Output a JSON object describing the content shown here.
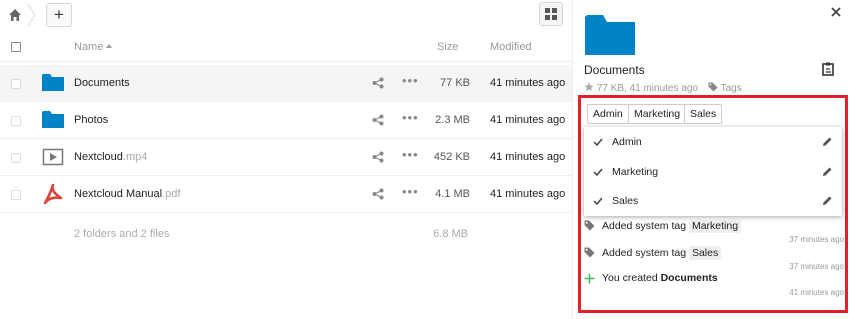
{
  "toolbar": {
    "add_label": "+"
  },
  "file_list": {
    "header": {
      "name": "Name",
      "size": "Size",
      "modified": "Modified"
    },
    "rows": [
      {
        "name": "Documents",
        "ext": "",
        "size": "77 KB",
        "modified": "41 minutes ago",
        "icon": "folder-icon"
      },
      {
        "name": "Photos",
        "ext": "",
        "size": "2.3 MB",
        "modified": "41 minutes ago",
        "icon": "folder-icon"
      },
      {
        "name": "Nextcloud",
        "ext": ".mp4",
        "size": "452 KB",
        "modified": "41 minutes ago",
        "icon": "video-file-icon"
      },
      {
        "name": "Nextcloud Manual",
        "ext": ".pdf",
        "size": "4.1 MB",
        "modified": "41 minutes ago",
        "icon": "pdf-file-icon"
      }
    ],
    "summary": {
      "text": "2 folders and 2 files",
      "size": "6.8 MB"
    }
  },
  "sidebar": {
    "title": "Documents",
    "meta": "77 KB, 41 minutes ago",
    "tags_label": "Tags",
    "selected_tags": [
      "Admin",
      "Marketing",
      "Sales"
    ],
    "dropdown": [
      {
        "label": "Admin",
        "checked": true
      },
      {
        "label": "Marketing",
        "checked": true
      },
      {
        "label": "Sales",
        "checked": true
      }
    ],
    "activity": [
      {
        "prefix": "Added system tag",
        "subject": "Marketing",
        "time": "37 minutes ago",
        "icon": "tag-icon"
      },
      {
        "prefix": "Added system tag",
        "subject": "Sales",
        "time": "37 minutes ago",
        "icon": "tag-icon"
      },
      {
        "prefix": "You created",
        "subject": "Documents",
        "time": "41 minutes ago",
        "icon": "plus-icon"
      }
    ]
  },
  "colors": {
    "folder": "#0082c9",
    "pdf": "#e2413a",
    "highlight_border": "#e0202a",
    "created_plus": "#46ba61"
  }
}
